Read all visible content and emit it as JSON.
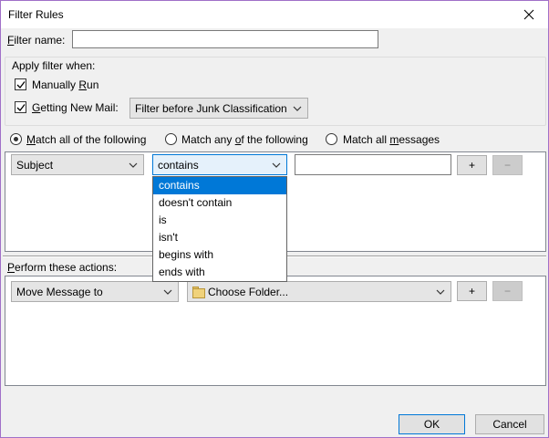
{
  "window": {
    "title": "Filter Rules",
    "close_glyph": "✕"
  },
  "filter_name": {
    "label": "Filter name:",
    "value": ""
  },
  "apply_group": {
    "legend": "Apply filter when:",
    "manually_run": {
      "label": "Manually Run",
      "checked": true
    },
    "getting_new_mail": {
      "label": "Getting New Mail:",
      "checked": true
    },
    "timing_select": "Filter before Junk Classification"
  },
  "match": {
    "all": "Match all of the following",
    "any": "Match any of the following",
    "all_messages": "Match all messages",
    "selected": "all"
  },
  "rule": {
    "field_select": "Subject",
    "operator_select": "contains",
    "value": "",
    "add_label": "+",
    "remove_label": "−"
  },
  "operator_dropdown": {
    "options": [
      "contains",
      "doesn't contain",
      "is",
      "isn't",
      "begins with",
      "ends with"
    ],
    "selected_index": 0
  },
  "actions": {
    "label": "Perform these actions:",
    "action_select": "Move Message to",
    "folder_select": "Choose Folder...",
    "add_label": "+",
    "remove_label": "−"
  },
  "buttons": {
    "ok": "OK",
    "cancel": "Cancel"
  },
  "colors": {
    "accent": "#0078d7",
    "window_border": "#a070c8"
  }
}
